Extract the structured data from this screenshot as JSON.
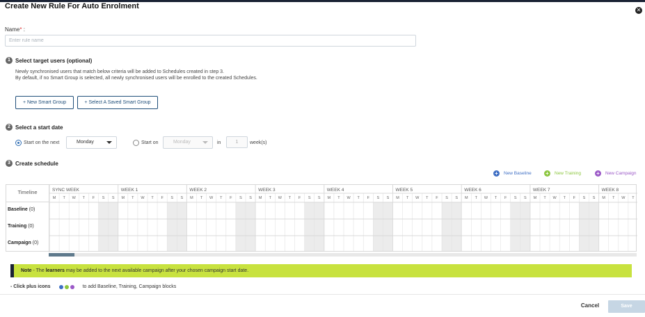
{
  "dialog": {
    "title": "Create New Rule For Auto Enrolment",
    "close_glyph": "✕"
  },
  "name": {
    "label": "Name",
    "required_mark": "*",
    "colon": ":",
    "placeholder": "Enter rule name",
    "value": ""
  },
  "step1": {
    "number": "1",
    "title": "Select target users (optional)",
    "desc_line1": "Newly synchronised users that match below criteria will be added to Schedules created in step 3.",
    "desc_line2": "By default, if no Smart Group is selected, all newly synchronised users will be enrolled to the created Schedules.",
    "new_smart_group": "+ New Smart Group",
    "select_saved_smart_group": "+ Select A Saved Smart Group"
  },
  "step2": {
    "number": "2",
    "title": "Select a start date",
    "option1_label": "Start on the next",
    "option1_selected": true,
    "option1_day": "Monday",
    "option2_label": "Start on",
    "option2_selected": false,
    "option2_day": "Monday",
    "in_label": "in",
    "weeks_value": "1",
    "weeks_label": "week(s)"
  },
  "step3": {
    "number": "3",
    "title": "Create schedule",
    "legend": [
      {
        "label": "New Baseline",
        "color": "#3f6fc4",
        "icon": "plus-circle-icon"
      },
      {
        "label": "New Training",
        "color": "#8cc63f",
        "icon": "plus-circle-icon"
      },
      {
        "label": "New Campaign",
        "color": "#9b59c7",
        "icon": "plus-circle-icon"
      }
    ],
    "timeline_header": "Timeline",
    "weeks": [
      "SYNC WEEK",
      "WEEK 1",
      "WEEK 2",
      "WEEK 3",
      "WEEK 4",
      "WEEK 5",
      "WEEK 6",
      "WEEK 7",
      "WEEK 8"
    ],
    "days": [
      "M",
      "T",
      "W",
      "T",
      "F",
      "S",
      "S"
    ],
    "rows": [
      {
        "name": "Baseline",
        "count": "(0)"
      },
      {
        "name": "Training",
        "count": "(0)"
      },
      {
        "name": "Campaign",
        "count": "(0)"
      }
    ]
  },
  "note": {
    "label": "Note",
    "text": " - The ",
    "learners": "learners",
    "text2": " may be added to the next available campaign after your chosen campaign start date."
  },
  "hint": {
    "prefix": "- Click plus icons",
    "suffix": "to add Baseline, Training, Campaign blocks"
  },
  "footer": {
    "cancel": "Cancel",
    "save": "Save"
  }
}
